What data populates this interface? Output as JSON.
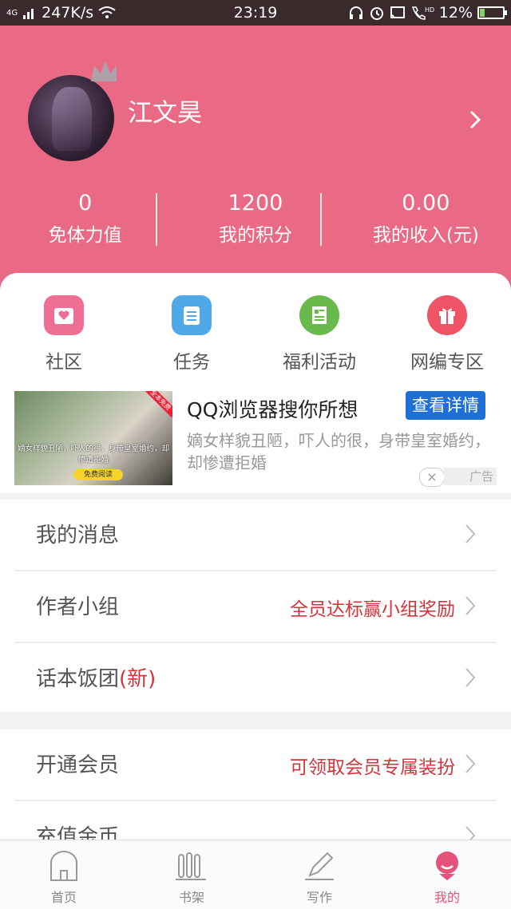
{
  "status_bar": {
    "network": "4G",
    "speed": "247K/s",
    "time": "23:19",
    "battery": "12%",
    "hd": "HD"
  },
  "profile": {
    "username": "江文昊",
    "stats": [
      {
        "value": "0",
        "label": "免体力值"
      },
      {
        "value": "1200",
        "label": "我的积分"
      },
      {
        "value": "0.00",
        "label": "我的收入(元)"
      }
    ]
  },
  "quick_actions": [
    {
      "label": "社区",
      "icon": "community-icon",
      "color": "#ef6e93"
    },
    {
      "label": "任务",
      "icon": "task-clipboard-icon",
      "color": "#4fa8e8"
    },
    {
      "label": "福利活动",
      "icon": "document-icon",
      "color": "#69b94c"
    },
    {
      "label": "网编专区",
      "icon": "gift-icon",
      "color": "#ee5366"
    }
  ],
  "ad": {
    "title": "QQ浏览器搜你所想",
    "button": "查看详情",
    "description": "嫡女样貌丑陋，吓人的很，身带皇室婚约，却惨遭拒婚",
    "label": "广告",
    "close": "×",
    "image_caption": "嫡女样貌丑陋，吓人的很，身带皇室婚约，却惨遭拒婚",
    "image_button": "免费阅读",
    "image_tag": "全本免费"
  },
  "menu_group_1": [
    {
      "label": "我的消息",
      "accent": "",
      "extra": ""
    },
    {
      "label": "作者小组",
      "accent": "",
      "extra": "全员达标赢小组奖励"
    },
    {
      "label": "话本饭团",
      "accent": "(新)",
      "extra": ""
    }
  ],
  "menu_group_2": [
    {
      "label": "开通会员",
      "extra": "可领取会员专属装扮"
    },
    {
      "label": "充值金币",
      "extra": ""
    }
  ],
  "tabs": [
    {
      "label": "首页",
      "icon": "home-icon",
      "active": false
    },
    {
      "label": "书架",
      "icon": "bookshelf-icon",
      "active": false
    },
    {
      "label": "写作",
      "icon": "pen-icon",
      "active": false
    },
    {
      "label": "我的",
      "icon": "profile-icon",
      "active": true
    }
  ],
  "colors": {
    "header": "#ea6a85",
    "accent_red": "#d2353d",
    "ad_button": "#1e6fd6",
    "active_tab": "#e5537a"
  }
}
